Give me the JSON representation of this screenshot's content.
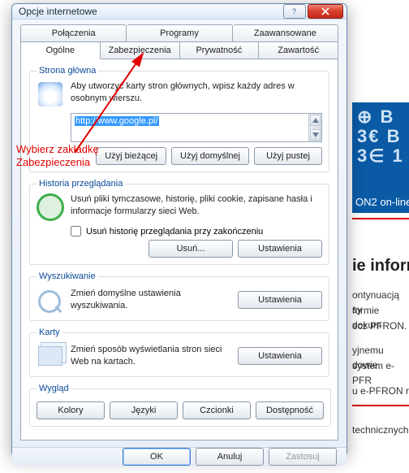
{
  "dialog": {
    "title": "Opcje internetowe",
    "tabs_row1": [
      "Połączenia",
      "Programy",
      "Zaawansowane"
    ],
    "tabs_row2": [
      "Ogólne",
      "Zabezpieczenia",
      "Prywatność",
      "Zawartość"
    ],
    "active_tab": "Ogólne"
  },
  "annotation": {
    "line1": "Wybierz zakładkę",
    "line2": "Zabezpieczenia"
  },
  "homepage": {
    "legend": "Strona główna",
    "desc": "Aby utworzyć karty stron głównych, wpisz każdy adres w osobnym wierszu.",
    "url": "http://www.google.pl/",
    "btn_current": "Użyj bieżącej",
    "btn_default": "Użyj domyślnej",
    "btn_blank": "Użyj pustej"
  },
  "history": {
    "legend": "Historia przeglądania",
    "desc": "Usuń pliki tymczasowe, historię, pliki cookie, zapisane hasła i informacje formularzy sieci Web.",
    "checkbox": "Usuń historię przeglądania przy zakończeniu",
    "btn_delete": "Usuń...",
    "btn_settings": "Ustawienia"
  },
  "search": {
    "legend": "Wyszukiwanie",
    "desc": "Zmień domyślne ustawienia wyszukiwania.",
    "btn_settings": "Ustawienia"
  },
  "tabs_section": {
    "legend": "Karty",
    "desc": "Zmień sposób wyświetlania stron sieci Web na kartach.",
    "btn_settings": "Ustawienia"
  },
  "appearance": {
    "legend": "Wygląd",
    "btn_colors": "Kolory",
    "btn_lang": "Języki",
    "btn_fonts": "Czcionki",
    "btn_access": "Dostępność"
  },
  "footer": {
    "ok": "OK",
    "cancel": "Anuluj",
    "apply": "Zastosuj"
  },
  "background": {
    "tab_label": "ON2 on-line",
    "heading": "ie inform",
    "para1a": "ontynuacją sy",
    "para1b": "formie dokum",
    "para1c": "ecz PFRON.",
    "para2a": "yjnemu dowie",
    "para2b": "system e-PFR",
    "para3": "u e-PFRON r",
    "para4": "technicznych",
    "digits1": "⊕ B",
    "digits2": "3€ B",
    "digits3": "3∈ 1"
  }
}
